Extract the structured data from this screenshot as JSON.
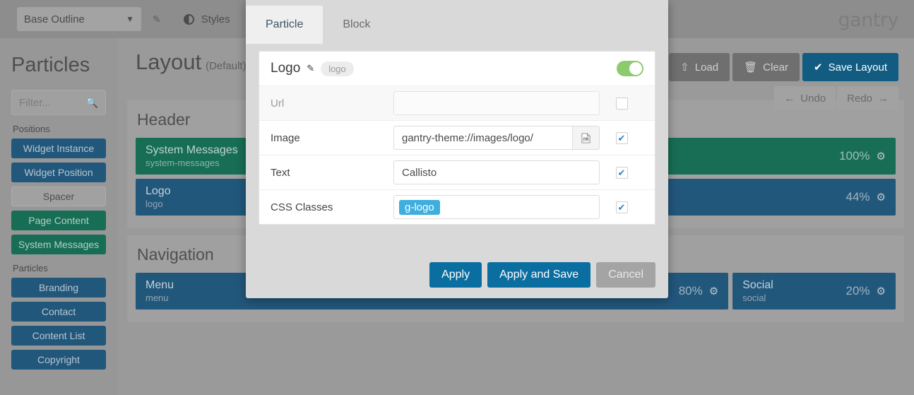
{
  "topbar": {
    "outline_value": "Base Outline",
    "chevron": "chevron-down",
    "edit_icon": "pencil",
    "styles_label": "Styles",
    "brand": "gantry"
  },
  "sidebar": {
    "title": "Particles",
    "filter_placeholder": "Filter...",
    "groups": [
      {
        "label": "Positions",
        "items": [
          {
            "label": "Widget Instance",
            "style": "blue"
          },
          {
            "label": "Widget Position",
            "style": "blue"
          },
          {
            "label": "Spacer",
            "style": "plain"
          },
          {
            "label": "Page Content",
            "style": "green"
          },
          {
            "label": "System Messages",
            "style": "green"
          }
        ]
      },
      {
        "label": "Particles",
        "items": [
          {
            "label": "Branding",
            "style": "blue"
          },
          {
            "label": "Contact",
            "style": "blue"
          },
          {
            "label": "Content List",
            "style": "blue"
          },
          {
            "label": "Copyright",
            "style": "blue"
          }
        ]
      }
    ]
  },
  "main": {
    "title": "Layout",
    "title_suffix": "(Default)",
    "buttons": [
      {
        "label": "Load",
        "icon": "branch-icon",
        "glyph": "⎇",
        "style": "grey"
      },
      {
        "label": "Clear",
        "icon": "trash-icon",
        "glyph": "🗑",
        "style": "grey"
      },
      {
        "label": "Save Layout",
        "icon": "check-icon",
        "glyph": "✔",
        "style": "primary"
      }
    ],
    "undo": {
      "label": "Undo",
      "glyph": "←"
    },
    "redo": {
      "label": "Redo",
      "glyph": "→"
    },
    "sections": [
      {
        "title": "Header",
        "rows": [
          [
            {
              "name": "System Messages",
              "key": "system-messages",
              "pct": "100%",
              "style": "green",
              "flex": 1
            }
          ],
          [
            {
              "name": "Logo",
              "key": "logo",
              "pct": "44%",
              "style": "blue",
              "flex": 1
            }
          ]
        ]
      },
      {
        "title": "Navigation",
        "rows": [
          [
            {
              "name": "Menu",
              "key": "menu",
              "pct": "80%",
              "style": "blue",
              "flex": 80
            },
            {
              "name": "Social",
              "key": "social",
              "pct": "20%",
              "style": "blue",
              "flex": 20
            }
          ]
        ]
      }
    ]
  },
  "modal": {
    "tabs": [
      {
        "label": "Particle",
        "active": true
      },
      {
        "label": "Block",
        "active": false
      }
    ],
    "card": {
      "title": "Logo",
      "edit_icon": "pencil",
      "badge": "logo",
      "enabled": true,
      "fields": [
        {
          "label": "Url",
          "value": "",
          "type": "text",
          "disabled": true,
          "checked": false,
          "name": "url"
        },
        {
          "label": "Image",
          "value": "gantry-theme://images/logo/",
          "type": "picker",
          "picker_icon": "image-picker-icon",
          "disabled": false,
          "checked": true,
          "name": "image"
        },
        {
          "label": "Text",
          "value": "Callisto",
          "type": "text",
          "disabled": false,
          "checked": true,
          "name": "text"
        },
        {
          "label": "CSS Classes",
          "value": "g-logo",
          "type": "tag",
          "disabled": false,
          "checked": true,
          "name": "css-classes"
        }
      ]
    },
    "footer": {
      "apply": "Apply",
      "apply_and_save": "Apply and Save",
      "cancel": "Cancel"
    }
  },
  "colors": {
    "primary": "#0b6ea0",
    "toggle_on": "#8ccb6b",
    "tag": "#3daedd",
    "position_green": "#176e54",
    "particle_blue": "#22577c"
  }
}
